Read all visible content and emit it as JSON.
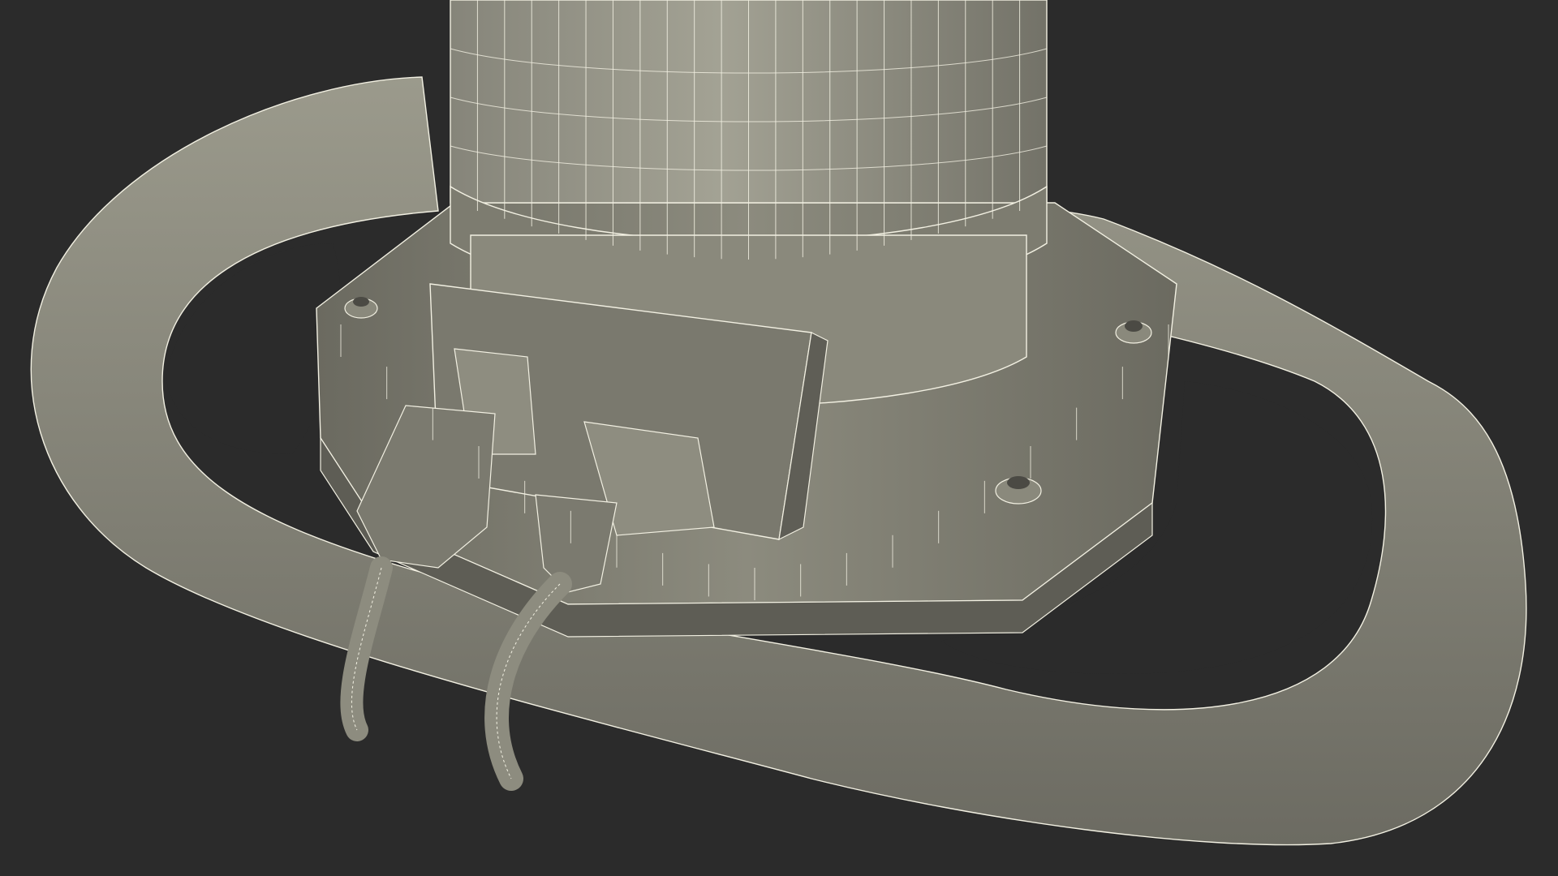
{
  "viewport": {
    "background": "#2b2b2b",
    "subject": "wireframe-render"
  },
  "colors": {
    "surface_dark": "#6f6e64",
    "surface_mid": "#878679",
    "surface_light": "#9a998b",
    "shadow": "#4e4d46",
    "wire": "#f2f0e2"
  }
}
